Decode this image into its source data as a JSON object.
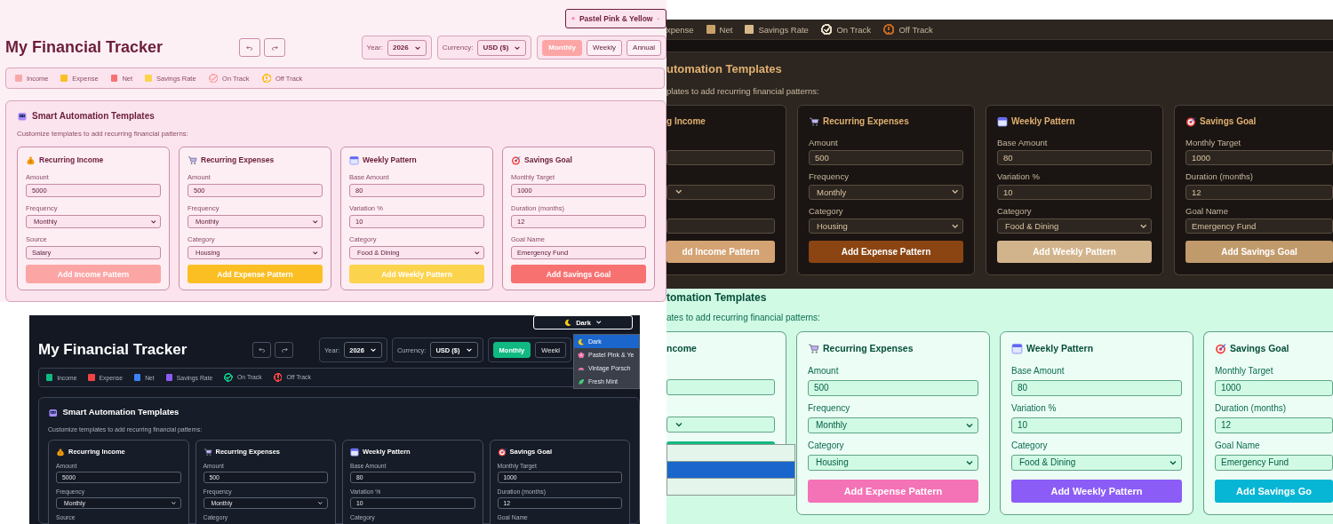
{
  "panels": [
    {
      "kind": "pastel",
      "theme_select": {
        "kind": "flower",
        "label": "Pastel Pink & Yellow"
      },
      "header": {
        "title": "My Financial Tracker",
        "year_label": "Year:",
        "year": "2026",
        "currency_label": "Currency:",
        "currency": "USD ($)",
        "periods": [
          {
            "label": "Monthly",
            "selected": true
          },
          {
            "label": "Weekly",
            "selected": false
          },
          {
            "label": "Annual",
            "selected": false
          }
        ]
      },
      "legend": [
        {
          "kind": "swatch",
          "label": "Income",
          "color": "#f9a8a8"
        },
        {
          "kind": "swatch",
          "label": "Expense",
          "color": "#fbbf24"
        },
        {
          "kind": "swatch",
          "label": "Net",
          "color": "#f87171"
        },
        {
          "kind": "swatch",
          "label": "Savings Rate",
          "color": "#fcd34d"
        },
        {
          "kind": "check",
          "label": "On Track",
          "color": "#f9a8a8"
        },
        {
          "kind": "alert",
          "label": "Off Track",
          "color": "#fbbf24"
        }
      ],
      "templates": {
        "title": "Smart Automation Templates",
        "description": "Customize templates to add recurring financial patterns:",
        "cards": [
          {
            "kind": "income",
            "title": "Recurring Income",
            "fields": [
              {
                "kind": "input",
                "label": "Amount",
                "value": "5000"
              },
              {
                "kind": "select",
                "label": "Frequency",
                "value": "Monthly"
              },
              {
                "kind": "input",
                "label": "Source",
                "value": "Salary"
              }
            ],
            "button": {
              "label": "Add Income Pattern",
              "color": "#fca5a5"
            }
          },
          {
            "kind": "expense",
            "title": "Recurring Expenses",
            "fields": [
              {
                "kind": "input",
                "label": "Amount",
                "value": "500"
              },
              {
                "kind": "select",
                "label": "Frequency",
                "value": "Monthly"
              },
              {
                "kind": "select",
                "label": "Category",
                "value": "Housing"
              }
            ],
            "button": {
              "label": "Add Expense Pattern",
              "color": "#fbbf24"
            }
          },
          {
            "kind": "weekly",
            "title": "Weekly Pattern",
            "fields": [
              {
                "kind": "input",
                "label": "Base Amount",
                "value": "80"
              },
              {
                "kind": "input",
                "label": "Variation %",
                "value": "10"
              },
              {
                "kind": "select",
                "label": "Category",
                "value": "Food & Dining"
              }
            ],
            "button": {
              "label": "Add Weekly Pattern",
              "color": "#fcd34d"
            }
          },
          {
            "kind": "savings",
            "title": "Savings Goal",
            "fields": [
              {
                "kind": "input",
                "label": "Monthly Target",
                "value": "1000"
              },
              {
                "kind": "input",
                "label": "Duration (months)",
                "value": "12"
              },
              {
                "kind": "input",
                "label": "Goal Name",
                "value": "Emergency Fund"
              }
            ],
            "button": {
              "label": "Add Savings Goal",
              "color": "#f87171"
            }
          }
        ]
      }
    },
    {
      "kind": "dark",
      "theme_select": {
        "kind": "moon",
        "label": "Dark"
      },
      "header": {
        "title": "My Financial Tracker",
        "year_label": "Year:",
        "year": "2026",
        "currency_label": "Currency:",
        "currency": "USD ($)",
        "periods": [
          {
            "label": "Monthly",
            "selected": true
          },
          {
            "label": "Weekl",
            "selected": false
          }
        ]
      },
      "theme_menu": [
        {
          "kind": "moon",
          "label": "Dark",
          "selected": true
        },
        {
          "kind": "flower",
          "label": "Pastel Pink & Ye",
          "selected": false
        },
        {
          "kind": "car",
          "label": "Vintage Porsch",
          "selected": false
        },
        {
          "kind": "leaf",
          "label": "Fresh Mint",
          "selected": false
        }
      ],
      "legend": [
        {
          "kind": "swatch",
          "label": "Income",
          "color": "#10b981"
        },
        {
          "kind": "swatch",
          "label": "Expense",
          "color": "#ef4444"
        },
        {
          "kind": "swatch",
          "label": "Net",
          "color": "#3b82f6"
        },
        {
          "kind": "swatch",
          "label": "Savings Rate",
          "color": "#8b5cf6"
        },
        {
          "kind": "check",
          "label": "On Track",
          "color": "#10b981"
        },
        {
          "kind": "alert",
          "label": "Off Track",
          "color": "#ef4444"
        }
      ],
      "templates": {
        "title": "Smart Automation Templates",
        "description": "Customize templates to add recurring financial patterns:",
        "cards": [
          {
            "kind": "income",
            "title": "Recurring Income",
            "fields": [
              {
                "kind": "input",
                "label": "Amount",
                "value": "5000"
              },
              {
                "kind": "select",
                "label": "Frequency",
                "value": "Monthly"
              },
              {
                "kind": "label",
                "label": "Source"
              }
            ]
          },
          {
            "kind": "expense",
            "title": "Recurring Expenses",
            "fields": [
              {
                "kind": "input",
                "label": "Amount",
                "value": "500"
              },
              {
                "kind": "select",
                "label": "Frequency",
                "value": "Monthly"
              },
              {
                "kind": "label",
                "label": "Category"
              }
            ]
          },
          {
            "kind": "weekly",
            "title": "Weekly Pattern",
            "fields": [
              {
                "kind": "input",
                "label": "Base Amount",
                "value": "80"
              },
              {
                "kind": "input",
                "label": "Variation %",
                "value": "10"
              },
              {
                "kind": "label",
                "label": "Category"
              }
            ]
          },
          {
            "kind": "savings",
            "title": "Savings Goal",
            "fields": [
              {
                "kind": "input",
                "label": "Monthly Target",
                "value": "1000"
              },
              {
                "kind": "input",
                "label": "Duration (months)",
                "value": "12"
              },
              {
                "kind": "label",
                "label": "Goal Name"
              }
            ]
          }
        ]
      }
    },
    {
      "kind": "vintage",
      "legend": [
        {
          "kind": "text",
          "label": "xpense"
        },
        {
          "kind": "swatch",
          "label": "Net",
          "color": "#c8a06a"
        },
        {
          "kind": "swatch",
          "label": "Savings Rate",
          "color": "#d9b98a"
        },
        {
          "kind": "check",
          "label": "On Track",
          "color": "#e8dcc8"
        },
        {
          "kind": "alert",
          "label": "Off Track",
          "color": "#c2661d"
        }
      ],
      "templates": {
        "title": "utomation Templates",
        "description": "plates to add recurring financial patterns:",
        "cards": [
          {
            "clipped_left": true,
            "title": "g Income",
            "fields": [
              {
                "kind": "input"
              },
              {
                "kind": "select"
              },
              {
                "kind": "input"
              }
            ],
            "button": {
              "label": "dd Income Pattern",
              "color": "#d4a373"
            }
          },
          {
            "kind": "expense",
            "title": "Recurring Expenses",
            "fields": [
              {
                "kind": "input",
                "label": "Amount",
                "value": "500"
              },
              {
                "kind": "select",
                "label": "Frequency",
                "value": "Monthly"
              },
              {
                "kind": "select",
                "label": "Category",
                "value": "Housing"
              }
            ],
            "button": {
              "label": "Add Expense Pattern",
              "color": "#8b4513"
            }
          },
          {
            "kind": "weekly",
            "title": "Weekly Pattern",
            "fields": [
              {
                "kind": "input",
                "label": "Base Amount",
                "value": "80"
              },
              {
                "kind": "input",
                "label": "Variation %",
                "value": "10"
              },
              {
                "kind": "select",
                "label": "Category",
                "value": "Food & Dining"
              }
            ],
            "button": {
              "label": "Add Weekly Pattern",
              "color": "#d2b48c"
            }
          },
          {
            "kind": "savings",
            "clipped_right": true,
            "title": "Savings Goal",
            "fields": [
              {
                "kind": "input",
                "label": "Monthly Target",
                "value": "1000"
              },
              {
                "kind": "input",
                "label": "Duration (months)",
                "value": "12"
              },
              {
                "kind": "input",
                "label": "Goal Name",
                "value": "Emergency Fund"
              }
            ],
            "button": {
              "label": "Add Savings Goal",
              "color": "#c19a6b"
            }
          }
        ]
      }
    },
    {
      "kind": "mint",
      "templates": {
        "title": "tomation Templates",
        "description": "ates to add recurring financial patterns:",
        "cards": [
          {
            "clipped_left": true,
            "title": "ncome",
            "fields": [
              {
                "kind": "input"
              },
              {
                "kind": "select"
              }
            ],
            "open_list": [
              {
                "selected": false
              },
              {
                "selected": true
              },
              {
                "selected": false
              }
            ],
            "button": {
              "color": "#10b981"
            }
          },
          {
            "kind": "expense",
            "title": "Recurring Expenses",
            "fields": [
              {
                "kind": "input",
                "label": "Amount",
                "value": "500"
              },
              {
                "kind": "select",
                "label": "Frequency",
                "value": "Monthly"
              },
              {
                "kind": "select",
                "label": "Category",
                "value": "Housing"
              }
            ],
            "button": {
              "label": "Add Expense Pattern",
              "color": "#f472b6"
            }
          },
          {
            "kind": "weekly",
            "title": "Weekly Pattern",
            "fields": [
              {
                "kind": "input",
                "label": "Base Amount",
                "value": "80"
              },
              {
                "kind": "input",
                "label": "Variation %",
                "value": "10"
              },
              {
                "kind": "select",
                "label": "Category",
                "value": "Food & Dining"
              }
            ],
            "button": {
              "label": "Add Weekly Pattern",
              "color": "#8b5cf6"
            }
          },
          {
            "kind": "savings",
            "clipped_right": true,
            "title": "Savings Goal",
            "fields": [
              {
                "kind": "input",
                "label": "Monthly Target",
                "value": "1000"
              },
              {
                "kind": "input",
                "label": "Duration (months)",
                "value": "12"
              },
              {
                "kind": "input",
                "label": "Goal Name",
                "value": "Emergency Fund"
              }
            ],
            "button": {
              "label": "Add Savings Go",
              "color": "#06b6d4"
            }
          }
        ]
      }
    }
  ]
}
